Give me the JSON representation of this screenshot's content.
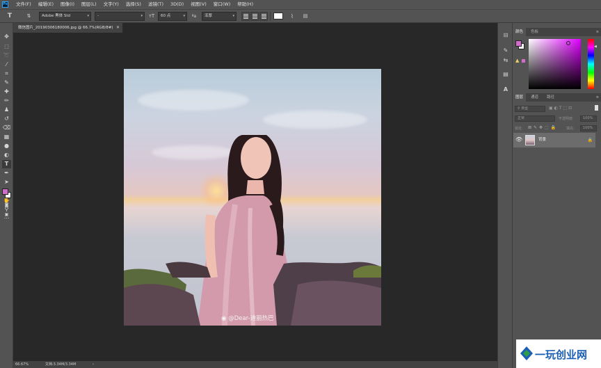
{
  "app": {
    "logo": "Ps"
  },
  "menu": [
    "文件(F)",
    "编辑(E)",
    "图像(I)",
    "图层(L)",
    "文字(Y)",
    "选择(S)",
    "滤镜(T)",
    "3D(D)",
    "视图(V)",
    "窗口(W)",
    "帮助(H)"
  ],
  "options": {
    "font_family": "Adobe 黑体 Std",
    "font_style": "-",
    "font_size": "60 点",
    "anti_alias": "浑厚"
  },
  "document": {
    "tab_title": "微信图片_20190306180006.jpg @ 66.7%(RGB/8#)",
    "watermark": "@Dear-迪丽热巴"
  },
  "status": {
    "zoom": "66.67%",
    "doc_info": "文档:3.34M/3.34M"
  },
  "panels": {
    "color_tabs": [
      "颜色",
      "色板"
    ],
    "layer_tabs": [
      "图层",
      "通道",
      "路径"
    ],
    "kind_filter": "类型",
    "blend_mode": "正常",
    "opacity_label": "不透明度:",
    "opacity_value": "100%",
    "lock_label": "锁定:",
    "fill_label": "填充:",
    "fill_value": "100%",
    "layer_name": "背景"
  },
  "colors": {
    "foreground": "#d06dc8",
    "background": "#ffffff",
    "accent": "#31a8ff"
  },
  "badge": {
    "text": "一玩创业网"
  }
}
